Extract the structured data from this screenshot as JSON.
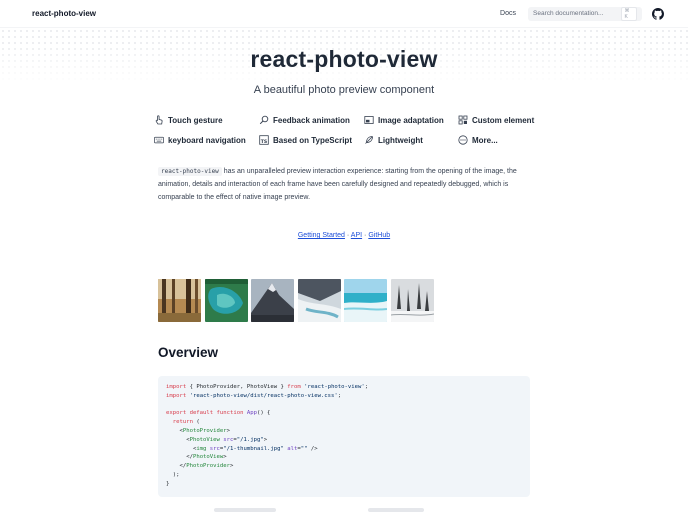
{
  "navbar": {
    "brand": "react-photo-view",
    "docs_link": "Docs",
    "search_placeholder": "Search documentation...",
    "search_shortcut": "⌘ K",
    "github_icon": "github-icon"
  },
  "hero": {
    "title": "react-photo-view",
    "subtitle": "A beautiful photo preview component"
  },
  "features": [
    {
      "label": "Touch gesture",
      "icon": "hand-pointer-icon"
    },
    {
      "label": "Feedback animation",
      "icon": "magnifier-icon"
    },
    {
      "label": "Image adaptation",
      "icon": "image-icon"
    },
    {
      "label": "Custom element",
      "icon": "grid-icon"
    },
    {
      "label": "keyboard navigation",
      "icon": "keyboard-icon"
    },
    {
      "label": "Based on TypeScript",
      "icon": "typescript-icon"
    },
    {
      "label": "Lightweight",
      "icon": "feather-icon"
    },
    {
      "label": "More...",
      "icon": "more-icon"
    }
  ],
  "intro": {
    "code": "react-photo-view",
    "text": " has an unparalleled preview interaction experience: starting from the opening of the image, the animation, details and interaction of each frame have been carefully designed and repeatedly debugged, which is comparable to the effect of native image preview."
  },
  "links": {
    "getting_started": "Getting Started",
    "sep1": " · ",
    "api": "API",
    "sep2": " · ",
    "github": "GitHub"
  },
  "gallery": {
    "thumbnails": [
      "forest-photo",
      "lagoon-photo",
      "mountain-photo",
      "glacier-photo",
      "beach-photo",
      "snow-trees-photo"
    ]
  },
  "overview": {
    "heading": "Overview"
  }
}
